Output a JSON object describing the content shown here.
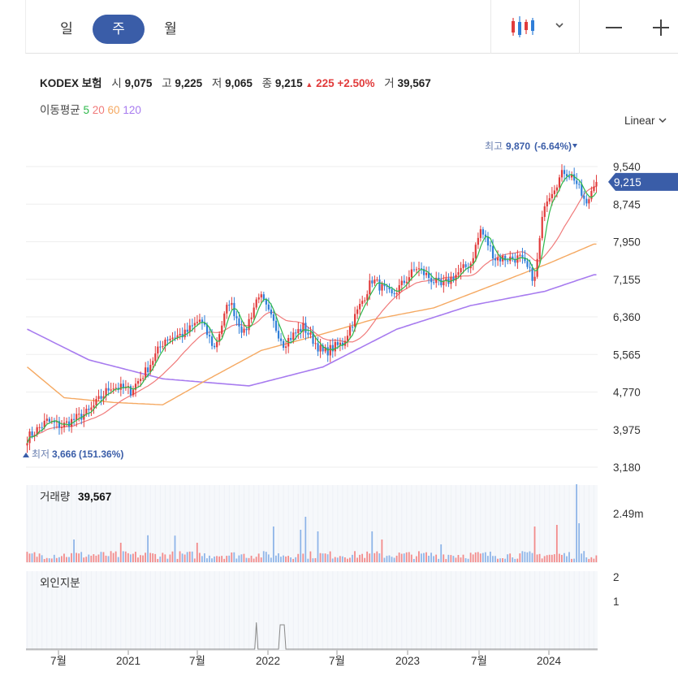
{
  "tabs": [
    {
      "label": "일",
      "active": false
    },
    {
      "label": "주",
      "active": true
    },
    {
      "label": "월",
      "active": false
    }
  ],
  "header": {
    "name": "KODEX 보험",
    "open_label": "시",
    "open": "9,075",
    "high_label": "고",
    "high": "9,225",
    "low_label": "저",
    "low": "9,065",
    "close_label": "종",
    "close": "9,215",
    "change": "225",
    "change_pct": "+2.50%",
    "volume_label": "거",
    "volume": "39,567",
    "up_color": "#e13b3b",
    "down_color": "#2f7ed8"
  },
  "ma": {
    "label": "이동평균",
    "items": [
      {
        "label": "5",
        "color": "#2db84a"
      },
      {
        "label": "20",
        "color": "#f07a7a"
      },
      {
        "label": "60",
        "color": "#f5a962"
      },
      {
        "label": "120",
        "color": "#a77bef"
      }
    ]
  },
  "scale_label": "Linear",
  "chart_data": {
    "type": "candlestick",
    "y_ticks": [
      "9,540",
      "8,745",
      "7,950",
      "7,155",
      "6,360",
      "5,565",
      "4,770",
      "3,975",
      "3,180"
    ],
    "y_tick_values": [
      9540,
      8745,
      7950,
      7155,
      6360,
      5565,
      4770,
      3975,
      3180
    ],
    "ylim": [
      2960,
      10100
    ],
    "x_ticks": [
      "7월",
      "2021",
      "7월",
      "2022",
      "7월",
      "2023",
      "7월",
      "2024"
    ],
    "current_price": "9,215",
    "max_annotation": {
      "label": "최고",
      "value": "9,870",
      "pct": "(-6.64%)"
    },
    "min_annotation": {
      "label": "최저",
      "value": "3,666",
      "pct": "(151.36%)"
    },
    "close_anchors": [
      [
        0,
        3800
      ],
      [
        8,
        4150
      ],
      [
        14,
        4050
      ],
      [
        25,
        4350
      ],
      [
        34,
        4900
      ],
      [
        42,
        4800
      ],
      [
        48,
        5200
      ],
      [
        56,
        5900
      ],
      [
        64,
        6000
      ],
      [
        70,
        6300
      ],
      [
        76,
        5700
      ],
      [
        82,
        6700
      ],
      [
        88,
        6000
      ],
      [
        94,
        6850
      ],
      [
        104,
        5800
      ],
      [
        112,
        6150
      ],
      [
        120,
        5600
      ],
      [
        128,
        5800
      ],
      [
        140,
        7150
      ],
      [
        148,
        6800
      ],
      [
        158,
        7400
      ],
      [
        168,
        7000
      ],
      [
        180,
        7500
      ],
      [
        184,
        8200
      ],
      [
        190,
        7600
      ],
      [
        200,
        7600
      ],
      [
        206,
        7150
      ],
      [
        210,
        8800
      ],
      [
        218,
        9450
      ],
      [
        222,
        9300
      ],
      [
        227,
        8700
      ],
      [
        230,
        9215
      ]
    ],
    "ma60_anchors": [
      [
        0,
        5300
      ],
      [
        15,
        4650
      ],
      [
        35,
        4550
      ],
      [
        55,
        4500
      ],
      [
        72,
        5000
      ],
      [
        95,
        5650
      ],
      [
        120,
        6000
      ],
      [
        140,
        6300
      ],
      [
        165,
        6550
      ],
      [
        190,
        7050
      ],
      [
        212,
        7500
      ],
      [
        230,
        7900
      ]
    ],
    "ma120_anchors": [
      [
        0,
        6100
      ],
      [
        25,
        5450
      ],
      [
        55,
        5050
      ],
      [
        90,
        4900
      ],
      [
        120,
        5300
      ],
      [
        150,
        6100
      ],
      [
        180,
        6600
      ],
      [
        210,
        6900
      ],
      [
        230,
        7250
      ]
    ],
    "volume_label": "거래량",
    "volume_value": "39,567",
    "volume_axis": "2.49m",
    "volume_spikes": [
      [
        19,
        70
      ],
      [
        38,
        60
      ],
      [
        49,
        83
      ],
      [
        60,
        82
      ],
      [
        69,
        60
      ],
      [
        100,
        110
      ],
      [
        111,
        100
      ],
      [
        113,
        140
      ],
      [
        118,
        95
      ],
      [
        140,
        95
      ],
      [
        144,
        70
      ],
      [
        168,
        55
      ],
      [
        206,
        110
      ],
      [
        215,
        115
      ],
      [
        223,
        240
      ],
      [
        224,
        120
      ]
    ],
    "foreign_label": "외인지분",
    "foreign_ticks": [
      "2",
      "1"
    ],
    "foreign_tick_values": [
      2,
      1
    ],
    "foreign_spikes": [
      [
        93,
        96
      ],
      [
        103,
        109
      ]
    ]
  }
}
